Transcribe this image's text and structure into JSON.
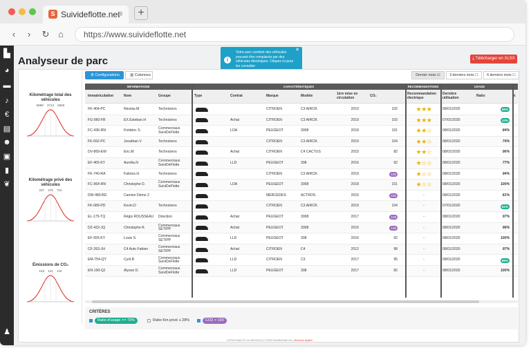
{
  "browser": {
    "tab_title": "Suivideflotte.net",
    "favicon_letter": "S",
    "url": "https://www.suivideflotte.net"
  },
  "page": {
    "title": "Analyseur de parc",
    "download_label": "Télécharger en XLSX"
  },
  "toast": {
    "text": "Votre parc contient des véhicules pouvant être remplacés par des véhicules électriques. Cliquez ici pour les consulter"
  },
  "controls": {
    "config": "Configurations",
    "columns": "Colonnes",
    "periods": [
      "Dernier mois",
      "3 derniers mois",
      "6 derniers mois"
    ]
  },
  "graphs": [
    {
      "title": "Kilométrage total des véhicules",
      "nums": "5858  3713  5566"
    },
    {
      "title": "Kilométrage privé des véhicules",
      "nums": "237  475  710"
    },
    {
      "title": "Émissions de CO₂",
      "nums": "103  121  144"
    }
  ],
  "table": {
    "groups": {
      "info": "INFORMATIONS",
      "car": "CARACTÉRISTIQUES",
      "reco": "RECOMMANDATIONS",
      "usage": "USAGE"
    },
    "headers": [
      "Immatriculation",
      "Nom",
      "Groupe",
      "Type",
      "Contrat",
      "Marque",
      "Modèle",
      "1ère mise en circulation",
      "CO₂",
      "Recommandation électrique",
      "Dernière utilisation",
      "Ratio",
      "%"
    ],
    "rows": [
      {
        "immat": "FK-404-PC",
        "nom": "Nicolas.M",
        "groupe": "Techniciens",
        "contrat": "",
        "marque": "CITROEN",
        "modele": "C3 AIRCR.",
        "annee": "2019",
        "co2": "102",
        "co2_hl": false,
        "stars": 3,
        "reco": "",
        "date": "08/01/2020",
        "ratio": "55%",
        "ratio_hl": true
      },
      {
        "immat": "FG-960-FB",
        "nom": "EX.Esteban.H",
        "groupe": "Techniciens",
        "contrat": "Achat",
        "marque": "CITROEN",
        "modele": "C3 AIRCR.",
        "annee": "2019",
        "co2": "103",
        "co2_hl": false,
        "stars": 3,
        "reco": "",
        "date": "07/01/2020",
        "ratio": "10%",
        "ratio_hl": true
      },
      {
        "immat": "FC-436-RN",
        "nom": "Frédéric S.",
        "groupe": "Commerciaux SuiviDeFlotte",
        "contrat": "LOA",
        "marque": "PEUGEOT",
        "modele": "3008",
        "annee": "2018",
        "co2": "101",
        "co2_hl": false,
        "stars": 2,
        "reco": "",
        "date": "08/01/2020",
        "ratio": "84%",
        "ratio_hl": false
      },
      {
        "immat": "FK-692-PC",
        "nom": "Jonathan.V",
        "groupe": "Techniciens",
        "contrat": "",
        "marque": "CITROEN",
        "modele": "C3 AIRCR.",
        "annee": "2019",
        "co2": "104",
        "co2_hl": false,
        "stars": 2,
        "reco": "",
        "date": "08/01/2020",
        "ratio": "74%",
        "ratio_hl": false
      },
      {
        "immat": "DV-869-EW",
        "nom": "Eric.M",
        "groupe": "Techniciens",
        "contrat": "Achat",
        "marque": "CITROEN",
        "modele": "C4 CACTUS",
        "annee": "2015",
        "co2": "82",
        "co2_hl": false,
        "stars": 2,
        "reco": "",
        "date": "08/01/2020",
        "ratio": "96%",
        "ratio_hl": false
      },
      {
        "immat": "EF-465-KY",
        "nom": "Aurélia.N",
        "groupe": "Commerciaux SuiviDeFlotte",
        "contrat": "LLD",
        "marque": "PEUGEOT",
        "modele": "308",
        "annee": "2016",
        "co2": "92",
        "co2_hl": false,
        "stars": 1,
        "reco": "",
        "date": "08/01/2020",
        "ratio": "77%",
        "ratio_hl": false
      },
      {
        "immat": "FK-740-RA",
        "nom": "Fabrice.H",
        "groupe": "Techniciens",
        "contrat": "",
        "marque": "CITROEN",
        "modele": "C3 AIRCR.",
        "annee": "2019",
        "co2": "106",
        "co2_hl": true,
        "stars": 1,
        "reco": "",
        "date": "08/01/2020",
        "ratio": "94%",
        "ratio_hl": false
      },
      {
        "immat": "FC-964-RN",
        "nom": "Christophe D.",
        "groupe": "Commerciaux SuiviDeFlotte",
        "contrat": "LOA",
        "marque": "PEUGEOT",
        "modele": "3008",
        "annee": "2018",
        "co2": "101",
        "co2_hl": false,
        "stars": 1,
        "reco": "",
        "date": "08/01/2020",
        "ratio": "100%",
        "ratio_hl": false
      },
      {
        "immat": "DW-489-BD",
        "nom": "Camion Démo 2",
        "groupe": "",
        "contrat": "",
        "marque": "MERCEDES",
        "modele": "ACTROS",
        "annee": "2015",
        "co2": "160",
        "co2_hl": true,
        "stars": 0,
        "reco": "-",
        "date": "08/01/2020",
        "ratio": "81%",
        "ratio_hl": false
      },
      {
        "immat": "FK-089-PD",
        "nom": "Kevin.D",
        "groupe": "Techniciens",
        "contrat": "",
        "marque": "CITROEN",
        "modele": "C3 AIRCR.",
        "annee": "2019",
        "co2": "104",
        "co2_hl": false,
        "stars": 0,
        "reco": "-",
        "date": "07/01/2020",
        "ratio": "61%",
        "ratio_hl": true
      },
      {
        "immat": "EL-175-TQ",
        "nom": "Régis ROUSSEAU",
        "groupe": "Direction",
        "contrat": "Achat",
        "marque": "PEUGEOT",
        "modele": "3008",
        "annee": "2017",
        "co2": "129",
        "co2_hl": true,
        "stars": 0,
        "reco": "-",
        "date": "08/01/2020",
        "ratio": "97%",
        "ratio_hl": false
      },
      {
        "immat": "DZ-422-JQ",
        "nom": "Christophe R.",
        "groupe": "Commerciaux SETIPP",
        "contrat": "Achat",
        "marque": "PEUGEOT",
        "modele": "3008",
        "annee": "2016",
        "co2": "108",
        "co2_hl": true,
        "stars": 0,
        "reco": "-",
        "date": "08/01/2020",
        "ratio": "96%",
        "ratio_hl": false
      },
      {
        "immat": "EF-555-KY",
        "nom": "Louis S.",
        "groupe": "Commerciaux SETIPP",
        "contrat": "LLD",
        "marque": "PEUGEOT",
        "modele": "308",
        "annee": "2016",
        "co2": "92",
        "co2_hl": false,
        "stars": 0,
        "reco": "-",
        "date": "08/01/2020",
        "ratio": "100%",
        "ratio_hl": false
      },
      {
        "immat": "CF-263-JH",
        "nom": "C4 Auto Fabien",
        "groupe": "Commerciaux SETIPP",
        "contrat": "Achat",
        "marque": "CITROEN",
        "modele": "C4",
        "annee": "2012",
        "co2": "98",
        "co2_hl": false,
        "stars": 0,
        "reco": "-",
        "date": "08/01/2020",
        "ratio": "97%",
        "ratio_hl": false
      },
      {
        "immat": "EM-754-QY",
        "nom": "Cyril.B",
        "groupe": "Commerciaux SuiviDeFlotte",
        "contrat": "LLD",
        "marque": "CITROEN",
        "modele": "C3",
        "annee": "2017",
        "co2": "95",
        "co2_hl": false,
        "stars": 0,
        "reco": "-",
        "date": "08/01/2020",
        "ratio": "65%",
        "ratio_hl": true
      },
      {
        "immat": "EN-190-QJ",
        "nom": "Alyson D.",
        "groupe": "Commerciaux SuiviDeFlotte",
        "contrat": "LLD",
        "marque": "PEUGEOT",
        "modele": "308",
        "annee": "2017",
        "co2": "82",
        "co2_hl": false,
        "stars": 0,
        "reco": "-",
        "date": "08/01/2020",
        "ratio": "100%",
        "ratio_hl": false
      }
    ]
  },
  "criteria": {
    "title": "CRITÈRES",
    "c1": "Ratio d'usage <= 70%",
    "c2": "Ratio Km privé ≤ 28%",
    "c3": "CO2 > 100"
  },
  "footer": {
    "text": "LOFIX2 Build 227 du 08/01/2019 | ©2020 SuiviDeFlotte.net | ",
    "link": "Mentions légales"
  },
  "colors": {
    "accent": "#2b95d6",
    "danger": "#e4433a",
    "co2": "#9b6bbf",
    "ratio": "#1fae8f",
    "star": "#e9b100"
  }
}
